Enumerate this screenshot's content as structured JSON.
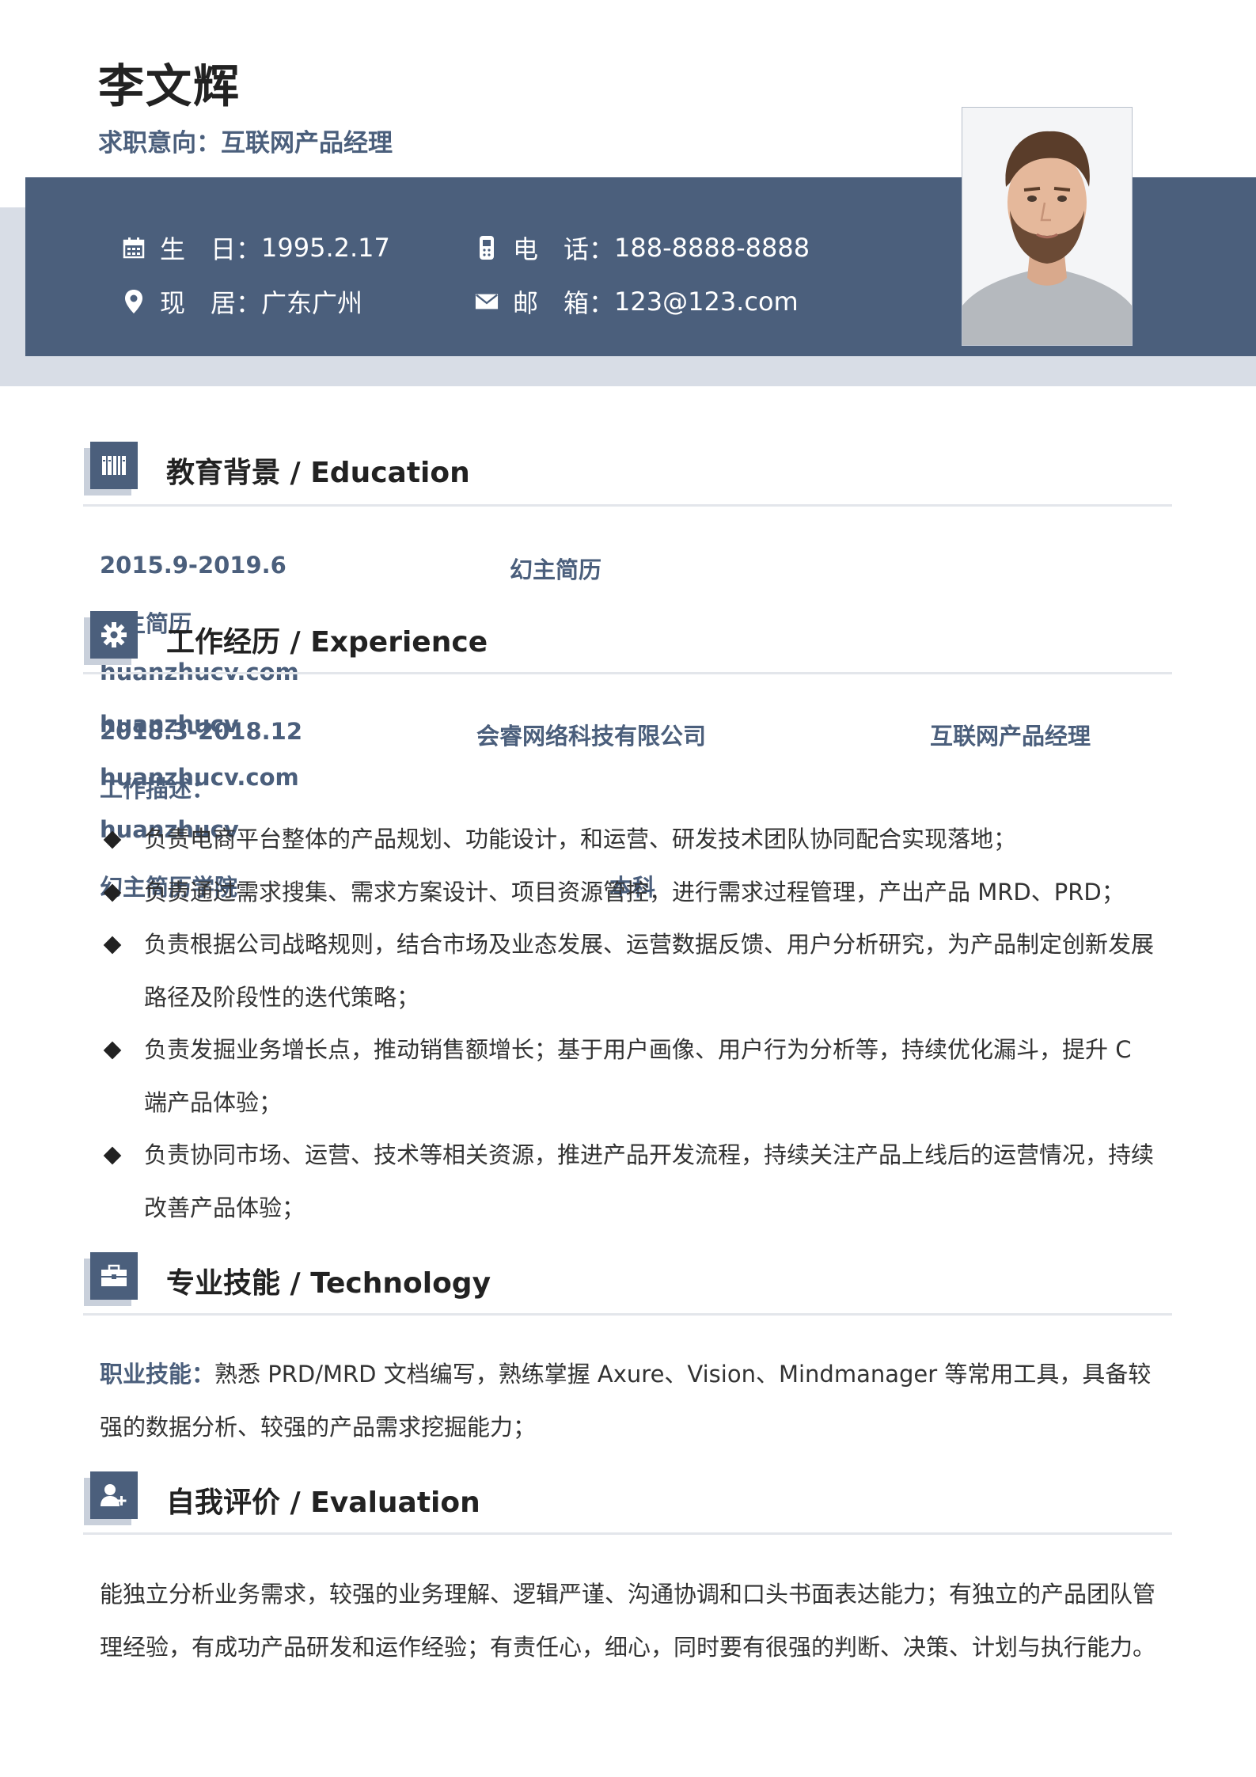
{
  "header": {
    "name": "李文辉",
    "intent_label": "求职意向：",
    "intent_value": "互联网产品经理"
  },
  "info": {
    "birth_label": "生　日：",
    "birth_value": "1995.2.17",
    "phone_label": "电　话：",
    "phone_value": "188-8888-8888",
    "location_label": "现　居：",
    "location_value": "广东广州",
    "email_label": "邮　箱：",
    "email_value": "123@123.com"
  },
  "education": {
    "title": "教育背景 / Education",
    "date": "2015.9-2019.6",
    "school": "幻主简历"
  },
  "watermarks": {
    "w1": "幻主简历",
    "w2": "huanzhucv.com",
    "w3": "huanzhucv",
    "w4": "huanzhucv.com",
    "w5": "huanzhucv",
    "w6": "幻主简历学院",
    "w7": "本科"
  },
  "experience": {
    "title": "工作经历 / Experience",
    "date": "2018.3-2018.12",
    "company": "会睿网络科技有限公司",
    "position": "互联网产品经理",
    "desc_label": "工作描述：",
    "bullets": [
      "负责电商平台整体的产品规划、功能设计，和运营、研发技术团队协同配合实现落地；",
      "负责通过需求搜集、需求方案设计、项目资源管控，进行需求过程管理，产出产品 MRD、PRD；",
      "负责根据公司战略规则，结合市场及业态发展、运营数据反馈、用户分析研究，为产品制定创新发展路径及阶段性的迭代策略；",
      "负责发掘业务增长点，推动销售额增长；基于用户画像、用户行为分析等，持续优化漏斗，提升 C 端产品体验；",
      "负责协同市场、运营、技术等相关资源，推进产品开发流程，持续关注产品上线后的运营情况，持续改善产品体验；"
    ]
  },
  "skills": {
    "title": "专业技能 / Technology",
    "label": "职业技能：",
    "text": "熟悉 PRD/MRD 文档编写，熟练掌握 Axure、Vision、Mindmanager 等常用工具，具备较强的数据分析、较强的产品需求挖掘能力；"
  },
  "evaluation": {
    "title": "自我评价 / Evaluation",
    "text": "能独立分析业务需求，较强的业务理解、逻辑严谨、沟通协调和口头书面表达能力；有独立的产品团队管理经验，有成功产品研发和运作经验；有责任心，细心，同时要有很强的判断、决策、计划与执行能力。"
  },
  "icons": {
    "calendar": "calendar-icon",
    "phone": "phone-icon",
    "location": "location-pin-icon",
    "email": "envelope-icon",
    "education": "books-icon",
    "experience": "gear-icon",
    "skills": "briefcase-icon",
    "evaluation": "user-plus-icon"
  },
  "colors": {
    "accent": "#4b5f7c",
    "band_light": "#d8dde6",
    "divider": "#e3e6eb"
  }
}
